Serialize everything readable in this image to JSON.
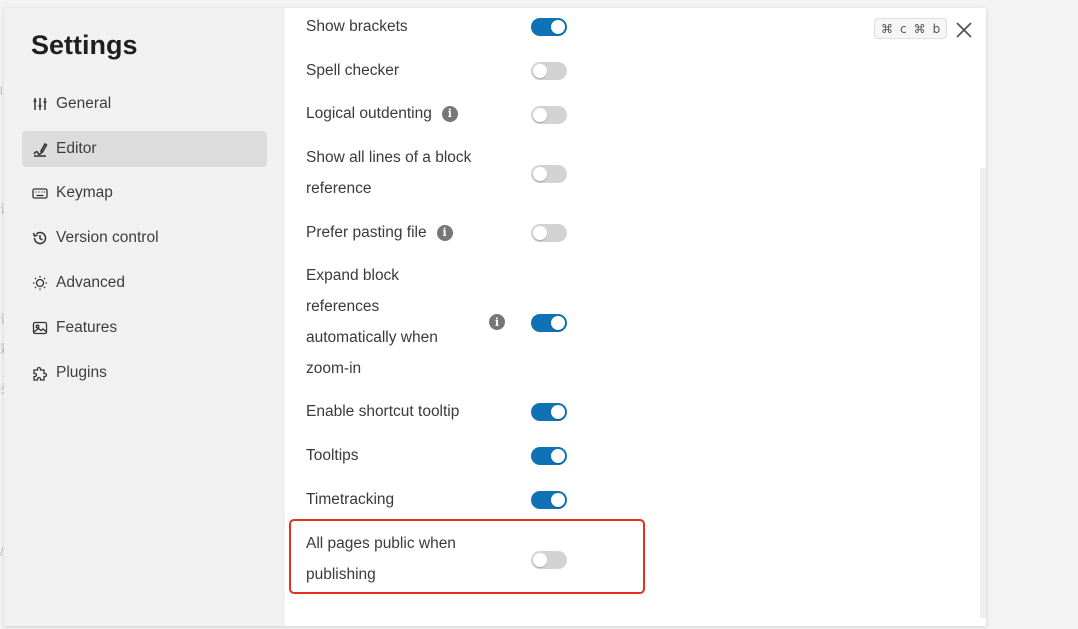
{
  "backdrop": {
    "chars": [
      "l",
      "设",
      "设",
      "彩",
      "头",
      "/"
    ]
  },
  "sidebar": {
    "title": "Settings",
    "items": [
      {
        "label": "General",
        "icon": "sliders-icon",
        "active": false
      },
      {
        "label": "Editor",
        "icon": "pen-icon",
        "active": true
      },
      {
        "label": "Keymap",
        "icon": "keyboard-icon",
        "active": false
      },
      {
        "label": "Version control",
        "icon": "history-icon",
        "active": false
      },
      {
        "label": "Advanced",
        "icon": "bulb-icon",
        "active": false
      },
      {
        "label": "Features",
        "icon": "image-icon",
        "active": false
      },
      {
        "label": "Plugins",
        "icon": "puzzle-icon",
        "active": false
      }
    ]
  },
  "shortcut": {
    "keys": [
      "⌘",
      "c",
      "⌘",
      "b"
    ]
  },
  "settings": [
    {
      "label": "Show brackets",
      "on": true,
      "info": false
    },
    {
      "label": "Spell checker",
      "on": false,
      "info": false
    },
    {
      "label": "Logical outdenting",
      "on": false,
      "info": true
    },
    {
      "label": "Show all lines of a block reference",
      "lines": [
        "Show all lines of a block",
        "reference"
      ],
      "on": false,
      "info": false
    },
    {
      "label": "Prefer pasting file",
      "on": false,
      "info": true
    },
    {
      "label": "Expand block references automatically when zoom-in",
      "lines": [
        "Expand block",
        "references",
        "automatically when",
        "zoom-in"
      ],
      "on": true,
      "info": true
    },
    {
      "label": "Enable shortcut tooltip",
      "on": true,
      "info": false
    },
    {
      "label": "Tooltips",
      "on": true,
      "info": false
    },
    {
      "label": "Timetracking",
      "on": true,
      "info": false
    },
    {
      "label": "All pages public when publishing",
      "lines": [
        "All pages public when",
        "publishing"
      ],
      "on": false,
      "info": false,
      "highlighted": true
    }
  ],
  "colors": {
    "toggle_on": "#0e72b5",
    "toggle_off": "#d3d3d3",
    "highlight": "#e0301e"
  }
}
